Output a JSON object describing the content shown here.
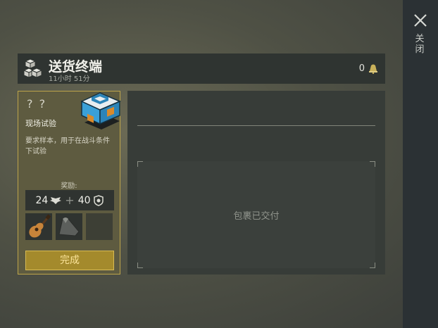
{
  "close": {
    "label": "关闭"
  },
  "header": {
    "title": "送货终端",
    "timer": "11小时 51分",
    "count": "0"
  },
  "card": {
    "unknown": "? ?",
    "name": "现场试验",
    "description": "要求样本，用于在战斗条件下试验",
    "reward_label": "奖励:",
    "reward_a": "24",
    "reward_b": "40",
    "complete_label": "完成"
  },
  "panel": {
    "empty_text": "包裹已交付"
  },
  "colors": {
    "accent_gold": "#bda44a",
    "button": "#a48a2c",
    "sidebar": "#2b3134"
  },
  "icons": [
    "close-icon",
    "cubes-icon",
    "bell-icon",
    "crate-icon",
    "wings-icon",
    "badge-icon",
    "guitar-icon",
    "metal-sheet-icon"
  ]
}
